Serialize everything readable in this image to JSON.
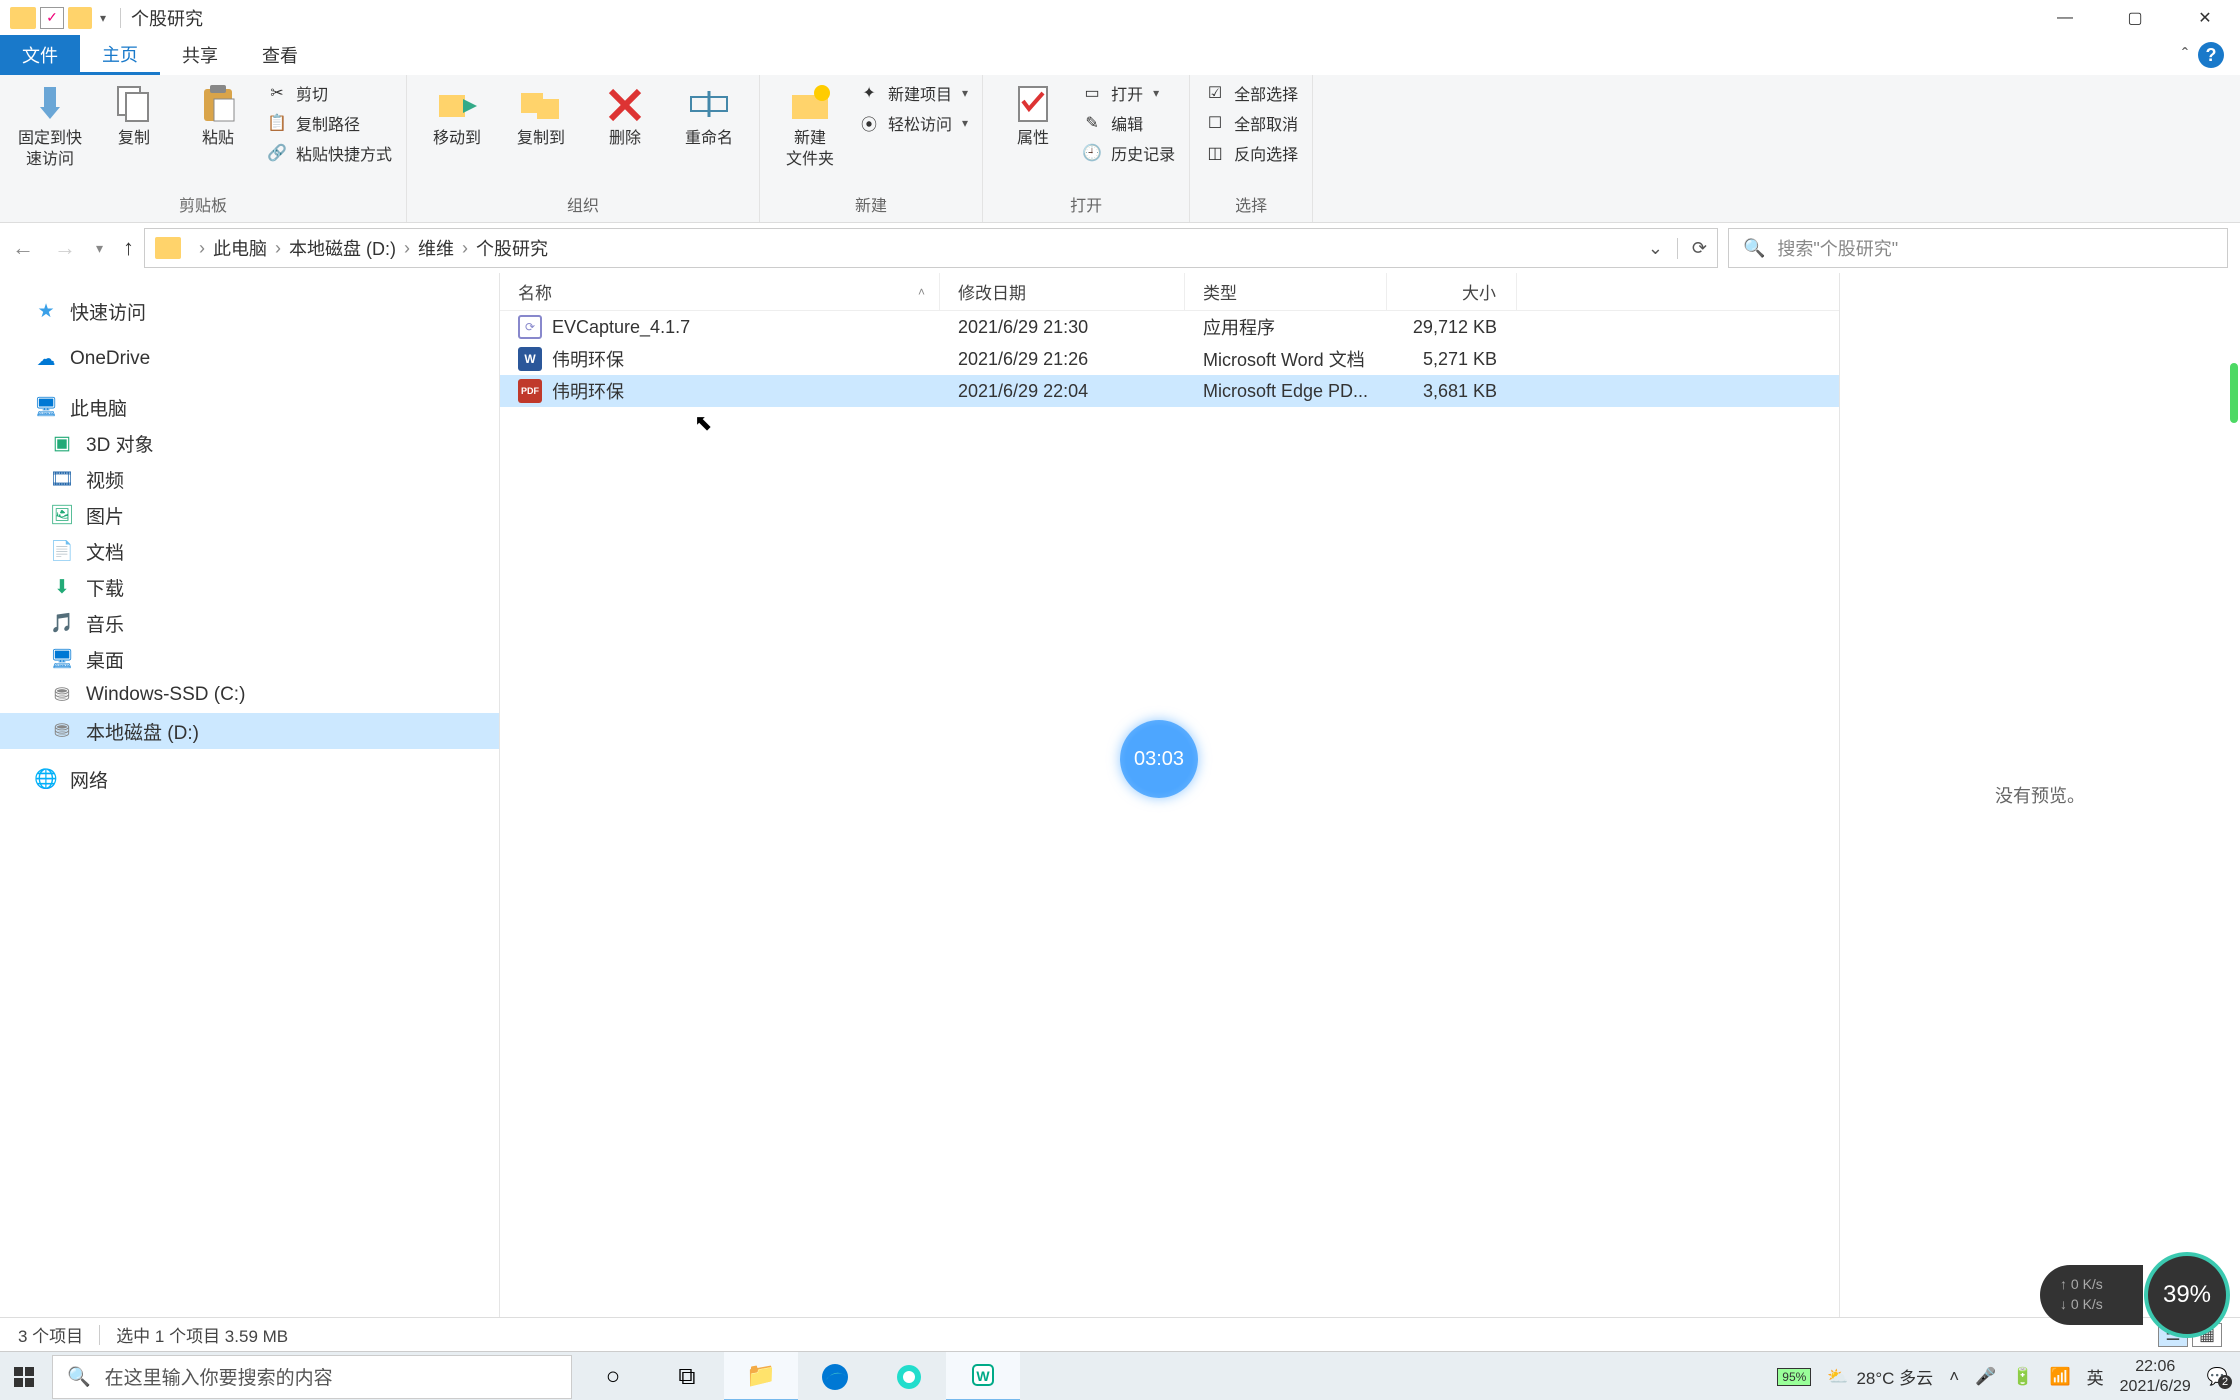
{
  "window": {
    "title": "个股研究"
  },
  "ribbon_tabs": {
    "file": "文件",
    "home": "主页",
    "share": "共享",
    "view": "查看"
  },
  "ribbon": {
    "clipboard": {
      "pin": "固定到快\n速访问",
      "copy": "复制",
      "paste": "粘贴",
      "cut": "剪切",
      "copy_path": "复制路径",
      "paste_shortcut": "粘贴快捷方式",
      "label": "剪贴板"
    },
    "organize": {
      "move_to": "移动到",
      "copy_to": "复制到",
      "delete": "删除",
      "rename": "重命名",
      "label": "组织"
    },
    "new": {
      "new_folder": "新建\n文件夹",
      "new_item": "新建项目",
      "easy_access": "轻松访问",
      "label": "新建"
    },
    "open": {
      "properties": "属性",
      "open": "打开",
      "edit": "编辑",
      "history": "历史记录",
      "label": "打开"
    },
    "select": {
      "select_all": "全部选择",
      "select_none": "全部取消",
      "invert": "反向选择",
      "label": "选择"
    }
  },
  "breadcrumb": {
    "pc": "此电脑",
    "drive": "本地磁盘 (D:)",
    "f1": "维维",
    "f2": "个股研究"
  },
  "search": {
    "placeholder": "搜索\"个股研究\""
  },
  "sidebar": {
    "quick": "快速访问",
    "onedrive": "OneDrive",
    "pc": "此电脑",
    "threed": "3D 对象",
    "video": "视频",
    "pictures": "图片",
    "docs": "文档",
    "downloads": "下载",
    "music": "音乐",
    "desktop": "桌面",
    "ssd": "Windows-SSD (C:)",
    "drive_d": "本地磁盘 (D:)",
    "network": "网络"
  },
  "columns": {
    "name": "名称",
    "date": "修改日期",
    "type": "类型",
    "size": "大小"
  },
  "files": [
    {
      "icon": "exe",
      "name": "EVCapture_4.1.7",
      "date": "2021/6/29 21:30",
      "type": "应用程序",
      "size": "29,712 KB"
    },
    {
      "icon": "doc",
      "name": "伟明环保",
      "date": "2021/6/29 21:26",
      "type": "Microsoft Word 文档",
      "size": "5,271 KB"
    },
    {
      "icon": "pdf",
      "name": "伟明环保",
      "date": "2021/6/29 22:04",
      "type": "Microsoft Edge PD...",
      "size": "3,681 KB"
    }
  ],
  "preview": {
    "none": "没有预览。"
  },
  "status": {
    "items": "3 个项目",
    "selected": "选中 1 个项目  3.59 MB"
  },
  "taskbar": {
    "search_placeholder": "在这里输入你要搜索的内容",
    "battery": "95%",
    "weather": "28°C 多云",
    "ime": "英",
    "time": "22:06",
    "date": "2021/6/29",
    "notif_count": "2"
  },
  "overlay": {
    "timer": "03:03",
    "net_up": "0 K/s",
    "net_down": "0 K/s",
    "cpu": "39%"
  }
}
